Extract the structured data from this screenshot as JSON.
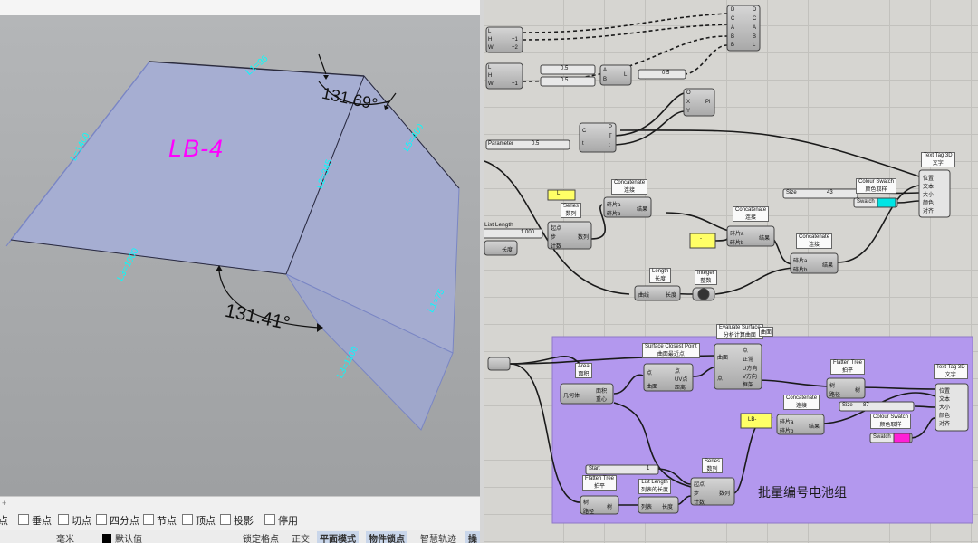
{
  "rhino_viewport": {
    "part_label": "LB-4",
    "angle_top": "131.69°",
    "angle_bottom": "131.41°",
    "dim_labels": [
      "L1=96",
      "L=1400",
      "L5=400",
      "L2=345",
      "L3=1000",
      "L1=75",
      "L3=1100",
      "L3=840"
    ],
    "status_strip_label": "+",
    "osnaps": [
      {
        "label": "点",
        "checked": false
      },
      {
        "label": "垂点",
        "checked": false
      },
      {
        "label": "切点",
        "checked": false
      },
      {
        "label": "四分点",
        "checked": false
      },
      {
        "label": "节点",
        "checked": false
      },
      {
        "label": "顶点",
        "checked": false
      },
      {
        "label": "投影",
        "checked": false
      },
      {
        "label": "停用",
        "checked": false
      }
    ],
    "status_items": [
      "毫米",
      "默认值",
      "锁定格点",
      "正交",
      "平面模式",
      "物件锁点",
      "智慧轨迹",
      "操"
    ],
    "layer_color": "#000000"
  },
  "grasshopper": {
    "group": {
      "label": "批量编号电池组",
      "color": "#b398ee"
    },
    "accent_colors": {
      "cyan_swatch": "#00e5e5",
      "magenta_swatch": "#ff1fd6",
      "yellow_panel": "#ffff66",
      "text_magenta": "#ff00ff",
      "dim_cyan": "#00ffff"
    },
    "nodes": {
      "gate": {
        "in": [
          "D",
          "C",
          "A",
          "B",
          "B"
        ],
        "out": [
          "D",
          "C",
          "A",
          "B",
          "L"
        ]
      },
      "pt1": {
        "in": [
          "L",
          "H",
          "W"
        ],
        "out": [
          "+1",
          "+2"
        ]
      },
      "pt2": {
        "in": [
          "L",
          "H",
          "W"
        ],
        "out": [
          "+1"
        ]
      },
      "slider_a": "0.5",
      "slider_b": "0.5",
      "line_ab": {
        "in": [
          "A",
          "B"
        ],
        "out": [
          "L"
        ]
      },
      "slider_c": "0.5",
      "oxy": {
        "in": [
          "O",
          "X",
          "Y"
        ],
        "out": [
          "Pl"
        ]
      },
      "dev": {
        "in": [
          "C",
          "t"
        ],
        "out": [
          "P",
          "T",
          "t"
        ]
      },
      "param_slider": {
        "name": "Parameter",
        "value": "0.5"
      },
      "text_tag_1": {
        "title": "Text Tag 3D",
        "sub": "文字",
        "inputs": [
          "位置",
          "文本",
          "大小",
          "颜色",
          "对齐"
        ]
      },
      "concat_1": {
        "title": "Concatenate",
        "sub": "连接",
        "in": [
          "碎片a",
          "碎片b"
        ],
        "out": "结果"
      },
      "panel_L": "L",
      "size_slider_1": {
        "name": "Size",
        "value": "43"
      },
      "swatch_1": {
        "title": "Colour Swatch",
        "sub": "颜色取样",
        "name": "Swatch"
      },
      "series_1": {
        "title": "Series",
        "sub": "数列",
        "in": [
          "起点",
          "步",
          "计数"
        ],
        "out": "数列"
      },
      "list_length_1": {
        "title": "List Length",
        "value": "1.000"
      },
      "cull": {
        "label": "长度"
      },
      "concat_2": {
        "title": "Concatenate",
        "sub": "连接",
        "in": [
          "碎片a",
          "碎片b"
        ],
        "out": "结果"
      },
      "panel_dash": "-",
      "concat_3": {
        "title": "Concatenate",
        "sub": "连接",
        "in": [
          "碎片a",
          "碎片b"
        ],
        "out": "结果"
      },
      "length_node": {
        "title": "Length",
        "sub": "长度",
        "in": "曲线",
        "out": "长度"
      },
      "integer_node": {
        "title": "Integer",
        "sub": "整数"
      },
      "evaluate_surface": {
        "title": "Evaluate Surface",
        "sub": "分析计算曲面",
        "tag": "曲面",
        "in": [
          "曲面",
          "点"
        ],
        "out": [
          "点",
          "正常",
          "U方向",
          "V方向",
          "框架"
        ]
      },
      "scp": {
        "title": "Surface Closest Point",
        "sub": "曲面最近点",
        "in": [
          "点",
          "曲面"
        ],
        "out": [
          "点",
          "UV点",
          "距离"
        ]
      },
      "area": {
        "title": "Area",
        "sub": "面积",
        "in": "几何体",
        "out": [
          "面积",
          "重心"
        ]
      },
      "flatten_1": {
        "title": "Flatten Tree",
        "sub": "拍平",
        "in": [
          "树",
          "路径"
        ],
        "out": "树"
      },
      "text_tag_2": {
        "title": "Text Tag 3D",
        "sub": "文字",
        "inputs": [
          "位置",
          "文本",
          "大小",
          "颜色",
          "对齐"
        ]
      },
      "concat_4": {
        "title": "Concatenate",
        "sub": "连接",
        "in": [
          "碎片a",
          "碎片b"
        ],
        "out": "结果"
      },
      "panel_lb": "LB-",
      "size_slider_2": {
        "name": "Size",
        "value": "87"
      },
      "swatch_2": {
        "title": "Colour Swatch",
        "sub": "颜色取样",
        "name": "Swatch"
      },
      "start_slider": {
        "name": "Start",
        "value": "1"
      },
      "series_2": {
        "title": "Series",
        "sub": "数列",
        "in": [
          "起点",
          "步",
          "计数"
        ],
        "out": "数列"
      },
      "list_length_2": {
        "title": "List Length",
        "sub": "列表的长度",
        "in": "列表",
        "out": "长度"
      },
      "flatten_2": {
        "title": "Flatten Tree",
        "sub": "拍平",
        "in": [
          "树",
          "路径"
        ],
        "out": "树"
      }
    }
  }
}
